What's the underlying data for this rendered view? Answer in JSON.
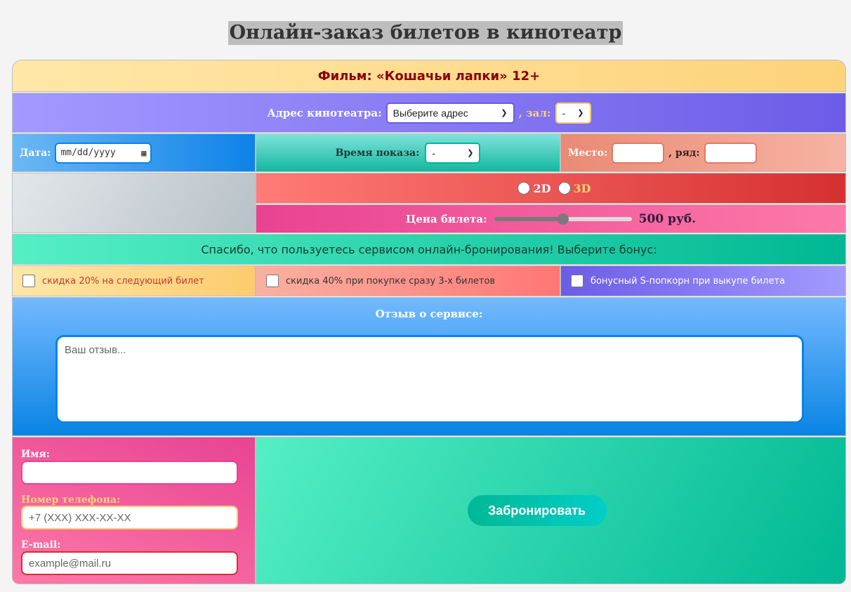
{
  "page_title": "Онлайн-заказ билетов в кинотеатр",
  "film": {
    "label": "Фильм: «Кошачьи лапки» 12+"
  },
  "address": {
    "label": "Адрес кинотеатра:",
    "select_value": "Выберите адрес",
    "hall_label": ", зал:",
    "hall_value": "-"
  },
  "date": {
    "label": "Дата:",
    "placeholder": "mm/dd/yyyy"
  },
  "time": {
    "label": "Время показа:",
    "select_value": "-"
  },
  "seat": {
    "place_label": "Место:",
    "row_label": ", ряд:"
  },
  "format": {
    "option_2d": "2D",
    "option_3d": "3D",
    "color_2d": "#ffffff",
    "color_3d": "#ffd27a"
  },
  "price": {
    "label": "Цена билета:",
    "value_text": "500 руб.",
    "slider_fraction": 0.5
  },
  "thanks_text": "Спасибо, что пользуетесь сервисом онлайн-бронирования! Выберите бонус:",
  "bonuses": [
    "скидка 20% на следующий билет",
    "скидка 40% при покупке сразу 3-х билетов",
    "бонусный S-попкорн при выкупе билета"
  ],
  "review": {
    "title": "Отзыв о сервисе:",
    "placeholder": "Ваш отзыв..."
  },
  "contact": {
    "name_label": "Имя:",
    "phone_label": "Номер телефона:",
    "phone_placeholder": "+7 (XXX) XXX-XX-XX",
    "email_label": "E-mail:",
    "email_placeholder": "example@mail.ru"
  },
  "submit_label": "Забронировать",
  "colors": {
    "accent": "#6c5ce7",
    "film_title": "#8b0000",
    "submit": "#00b894"
  }
}
